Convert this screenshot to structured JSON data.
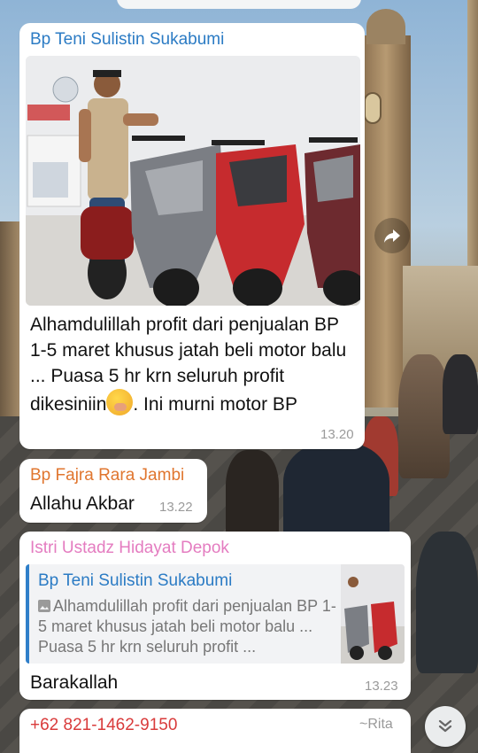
{
  "chat": {
    "messages": [
      {
        "sender": "Bp Teni Sulistin Sukabumi",
        "text": "Alhamdulillah profit dari penjualan BP 1-5 maret khusus jatah beli motor balu ... Puasa 5 hr krn seluruh profit dikesiniin",
        "text_after_emoji": ". Ini murni motor BP",
        "emoji": "face-with-hand-over-mouth",
        "time": "13.20",
        "has_photo": true
      },
      {
        "sender": "Bp Fajra Rara Jambi",
        "text": "Allahu Akbar",
        "time": "13.22"
      },
      {
        "sender": "Istri Ustadz Hidayat Depok",
        "reply_to": {
          "name": "Bp Teni Sulistin Sukabumi",
          "preview": "Alhamdulillah profit dari penjualan BP 1-5 maret khusus jatah beli motor balu ... Puasa 5 hr krn seluruh profit ..."
        },
        "text": "Barakallah",
        "time": "13.23"
      },
      {
        "sender": "+62 821-1462-9150",
        "nickname": "~Rita"
      }
    ]
  },
  "colors": {
    "sender_blue": "#2b7bc4",
    "sender_orange": "#e0762f",
    "sender_pink": "#e47cc0",
    "sender_red": "#d93b3b"
  },
  "icons": {
    "forward": "forward-icon",
    "scroll_down": "double-chevron-down-icon",
    "photo": "photo-icon"
  }
}
